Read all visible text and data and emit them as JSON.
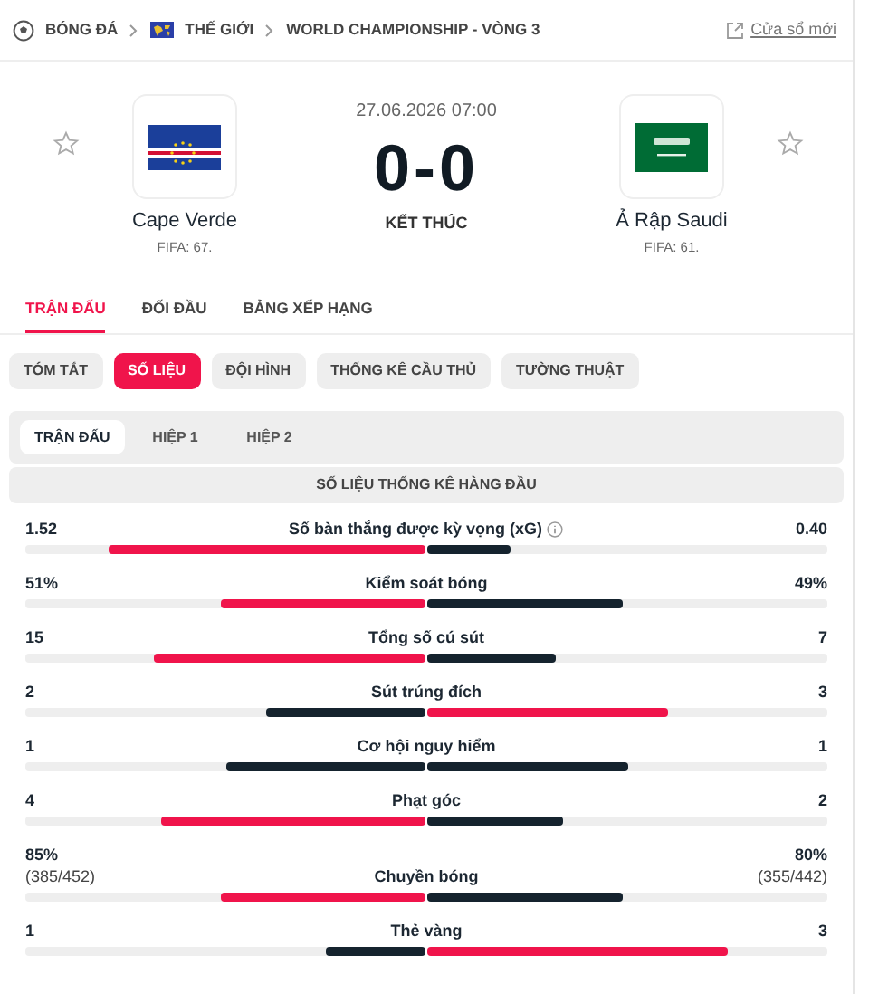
{
  "breadcrumb": [
    {
      "kind": "sport",
      "label": "BÓNG ĐÁ"
    },
    {
      "kind": "region",
      "label": "THẾ GIỚI"
    },
    {
      "kind": "plain",
      "label": "WORLD CHAMPIONSHIP - VÒNG 3"
    }
  ],
  "new_window_link": "Cửa sổ mới",
  "match": {
    "datetime": "27.06.2026 07:00",
    "score": "0-0",
    "status": "KẾT THÚC",
    "home": {
      "name": "Cape Verde",
      "ranking": "FIFA: 67.",
      "favorite": false
    },
    "away": {
      "name": "Ả Rập Saudi",
      "ranking": "FIFA: 61.",
      "favorite": false
    }
  },
  "tabs": [
    {
      "label": "TRẬN ĐẤU",
      "selected": true
    },
    {
      "label": "ĐỐI ĐẦU",
      "selected": false
    },
    {
      "label": "BẢNG XẾP HẠNG",
      "selected": false
    }
  ],
  "pills": [
    {
      "label": "TÓM TẮT",
      "selected": false
    },
    {
      "label": "SỐ LIỆU",
      "selected": true
    },
    {
      "label": "ĐỘI HÌNH",
      "selected": false
    },
    {
      "label": "THỐNG KÊ CẦU THỦ",
      "selected": false
    },
    {
      "label": "TƯỜNG THUẬT",
      "selected": false
    }
  ],
  "periods": [
    {
      "label": "TRẬN ĐẤU",
      "selected": true
    },
    {
      "label": "HIỆP 1",
      "selected": false
    },
    {
      "label": "HIỆP 2",
      "selected": false
    }
  ],
  "section_title": "SỐ LIỆU THỐNG KÊ HÀNG ĐẦU",
  "stats": [
    {
      "name": "Số bàn thắng được kỳ vọng (xG)",
      "info": true,
      "home": "1.52",
      "away": "0.40",
      "home_bar": {
        "level": 0.79,
        "color": "#f0144b"
      },
      "away_bar": {
        "level": 0.21,
        "color": "#15232e"
      }
    },
    {
      "name": "Kiểm soát bóng",
      "info": false,
      "home": "51%",
      "away": "49%",
      "home_bar": {
        "level": 0.51,
        "color": "#f0144b"
      },
      "away_bar": {
        "level": 0.49,
        "color": "#15232e"
      }
    },
    {
      "name": "Tổng số cú sút",
      "info": false,
      "home": "15",
      "away": "7",
      "home_bar": {
        "level": 0.68,
        "color": "#f0144b"
      },
      "away_bar": {
        "level": 0.32,
        "color": "#15232e"
      }
    },
    {
      "name": "Sút trúng đích",
      "info": false,
      "home": "2",
      "away": "3",
      "home_bar": {
        "level": 0.4,
        "color": "#15232e"
      },
      "away_bar": {
        "level": 0.6,
        "color": "#f0144b"
      }
    },
    {
      "name": "Cơ hội nguy hiểm",
      "info": false,
      "home": "1",
      "away": "1",
      "home_bar": {
        "level": 0.5,
        "color": "#15232e"
      },
      "away_bar": {
        "level": 0.5,
        "color": "#15232e"
      }
    },
    {
      "name": "Phạt góc",
      "info": false,
      "home": "4",
      "away": "2",
      "home_bar": {
        "level": 0.66,
        "color": "#f0144b"
      },
      "away_bar": {
        "level": 0.34,
        "color": "#15232e"
      }
    },
    {
      "name": "Chuyền bóng",
      "info": false,
      "home": "85%",
      "home_detail": "(385/452)",
      "away": "80%",
      "away_detail": "(355/442)",
      "home_bar": {
        "level": 0.51,
        "color": "#f0144b"
      },
      "away_bar": {
        "level": 0.49,
        "color": "#15232e"
      }
    },
    {
      "name": "Thẻ vàng",
      "info": false,
      "home": "1",
      "away": "3",
      "home_bar": {
        "level": 0.25,
        "color": "#15232e"
      },
      "away_bar": {
        "level": 0.75,
        "color": "#f0144b"
      }
    }
  ]
}
